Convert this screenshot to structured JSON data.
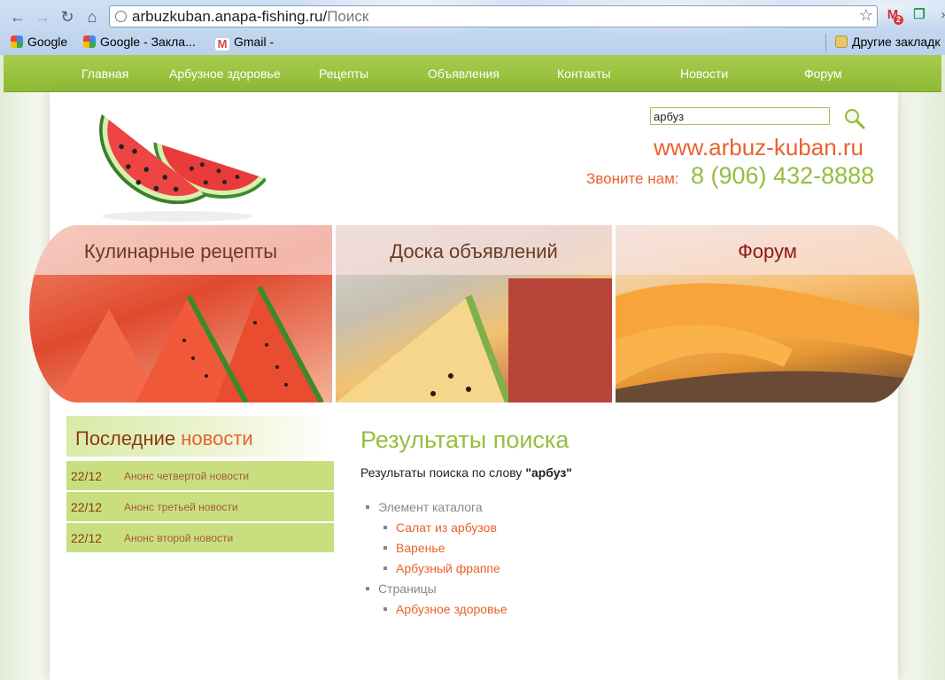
{
  "browser": {
    "url_host": "arbuzkuban.anapa-fishing.ru/",
    "url_path": "Поиск",
    "bookmarks": [
      {
        "label": "Google",
        "icon": "google-icon"
      },
      {
        "label": "Google - Закла...",
        "icon": "google-icon"
      },
      {
        "label": "Gmail -",
        "icon": "gmail-icon"
      },
      {
        "label": "Другие закладк",
        "icon": "folder-icon"
      }
    ],
    "gmail_badge": "2"
  },
  "nav": [
    "Главная",
    "Арбузное здоровье",
    "Рецепты",
    "Объявления",
    "Контакты",
    "Новости",
    "Форум"
  ],
  "header": {
    "search_value": "арбуз",
    "site_url": "www.arbuz-kuban.ru",
    "call_label": "Звоните нам:",
    "phone": "8 (906) 432-8888"
  },
  "banners": [
    "Кулинарные рецепты",
    "Доска объявлений",
    "Форум"
  ],
  "news": {
    "title_part1": "Последние",
    "title_part2": "новости",
    "items": [
      {
        "date": "22/12",
        "text": "Анонс четвертой новости"
      },
      {
        "date": "22/12",
        "text": "Анонс третьей новости"
      },
      {
        "date": "22/12",
        "text": "Анонс второй новости"
      }
    ]
  },
  "results": {
    "title": "Результаты поиска",
    "subtitle": "Результаты поиска по слову",
    "query": "\"арбуз\"",
    "groups": [
      {
        "label": "Элемент каталога",
        "items": [
          "Салат из арбузов",
          "Варенье",
          "Арбузный фраппе"
        ]
      },
      {
        "label": "Страницы",
        "items": [
          "Арбузное здоровье"
        ]
      }
    ]
  },
  "colors": {
    "accent_green": "#96bd3e",
    "accent_orange": "#e8622c",
    "nav_green": "#9cc541",
    "news_bg": "#c9df7f"
  }
}
